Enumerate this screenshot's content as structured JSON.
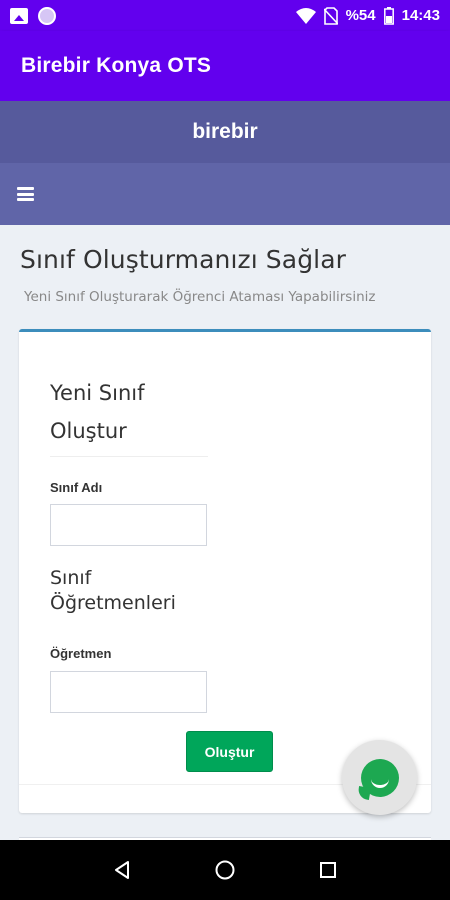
{
  "status_bar": {
    "battery": "%54",
    "time": "14:43",
    "icons": [
      "image-icon",
      "circle-icon",
      "wifi-icon",
      "no-sim-icon",
      "battery-icon"
    ]
  },
  "app_bar": {
    "title": "Birebir Konya OTS"
  },
  "brand": {
    "name": "birebir"
  },
  "nav": {
    "menu_icon": "hamburger-icon"
  },
  "page": {
    "title": "Sınıf Oluşturmanızı Sağlar",
    "subtitle": "Yeni Sınıf Oluşturarak Öğrenci Ataması Yapabilirsiniz"
  },
  "form": {
    "title": "Yeni Sınıf Oluştur",
    "class_name_label": "Sınıf Adı",
    "class_name_value": "",
    "teachers_section_title": "Sınıf Öğretmenleri",
    "teacher_label": "Öğretmen",
    "teacher_value": "",
    "submit_label": "Oluştur"
  },
  "colors": {
    "app_bar": "#6200ee",
    "brand_bar": "#565a9c",
    "nav_bar": "#6065a8",
    "box_border": "#3c8dbc",
    "submit_button": "#00a65a",
    "chat_bubble": "#1da851"
  },
  "system_nav": {
    "icons": [
      "back-icon",
      "home-icon",
      "recents-icon"
    ]
  }
}
